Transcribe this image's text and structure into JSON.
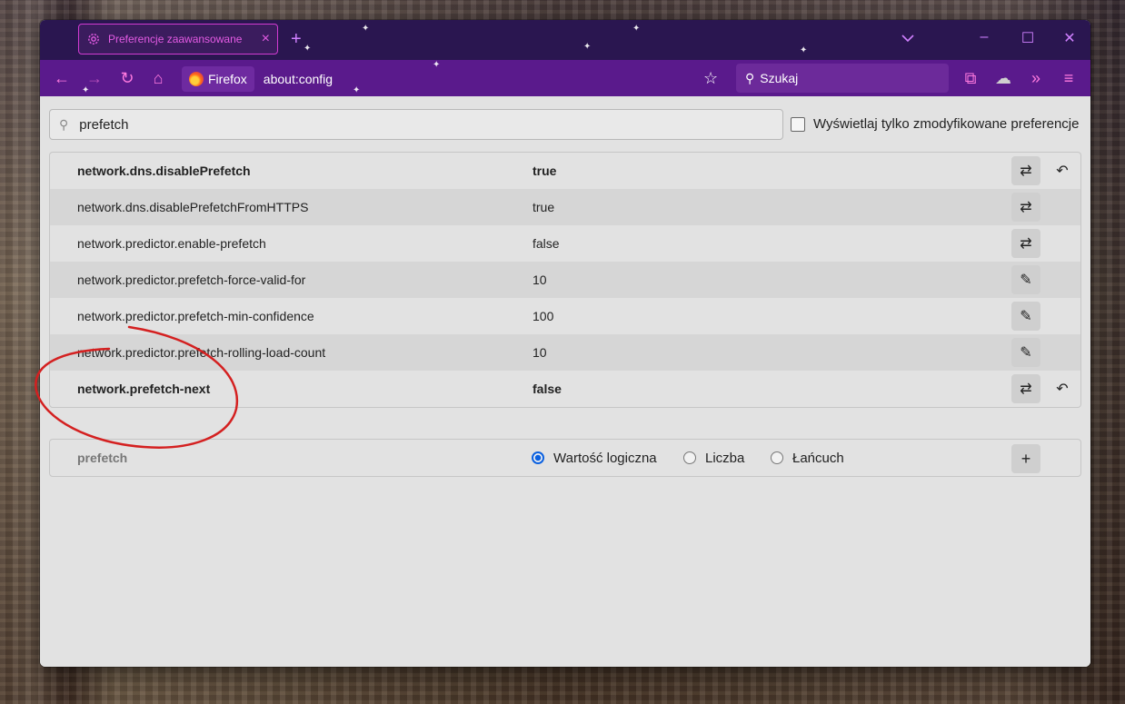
{
  "tabs": [
    {
      "title": "Preferencje zaawansowane",
      "icon": "gear-icon"
    }
  ],
  "toolbar": {
    "identity_label": "Firefox",
    "url": "about:config",
    "search_placeholder": "Szukaj"
  },
  "filter": {
    "value": "prefetch",
    "modified_only_label": "Wyświetlaj tylko zmodyfikowane preferencje"
  },
  "prefs": [
    {
      "name": "network.dns.disablePrefetch",
      "value": "true",
      "modified": true,
      "action": "toggle"
    },
    {
      "name": "network.dns.disablePrefetchFromHTTPS",
      "value": "true",
      "modified": false,
      "action": "toggle"
    },
    {
      "name": "network.predictor.enable-prefetch",
      "value": "false",
      "modified": false,
      "action": "toggle"
    },
    {
      "name": "network.predictor.prefetch-force-valid-for",
      "value": "10",
      "modified": false,
      "action": "edit"
    },
    {
      "name": "network.predictor.prefetch-min-confidence",
      "value": "100",
      "modified": false,
      "action": "edit"
    },
    {
      "name": "network.predictor.prefetch-rolling-load-count",
      "value": "10",
      "modified": false,
      "action": "edit"
    },
    {
      "name": "network.prefetch-next",
      "value": "false",
      "modified": true,
      "action": "toggle"
    }
  ],
  "add_row": {
    "name": "prefetch",
    "types": [
      "Wartość logiczna",
      "Liczba",
      "Łańcuch"
    ],
    "selected_type": "Wartość logiczna"
  },
  "colors": {
    "tabbar": "#2a1650",
    "navbar": "#5a1a8c",
    "accent": "#e45be4",
    "annotation": "#d42020"
  }
}
